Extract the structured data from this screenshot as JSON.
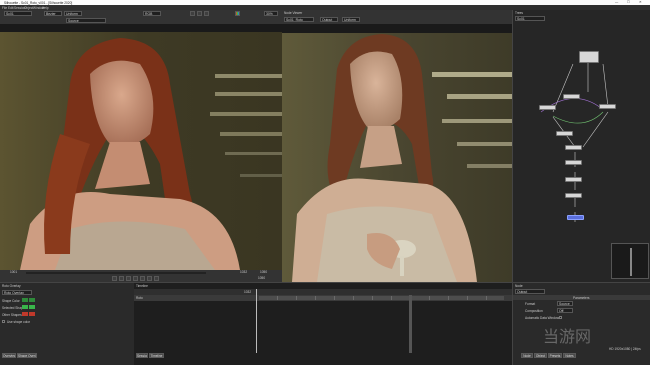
{
  "window": {
    "title": "Silhouette - Sc01_Roto_v001 - [Silhouette 2020]"
  },
  "menubar": {
    "items": [
      "File",
      "Edit",
      "Session",
      "Object",
      "Window",
      "Help"
    ]
  },
  "toolbar": {
    "session_select": "Sc01",
    "view_select": "Bezier",
    "mode_select": "Uniform",
    "color_select": "RGB",
    "zoom_value": "30%"
  },
  "left_viewer": {
    "tab_label": "Source",
    "frame_start": "1001",
    "frame_end": "1050",
    "frame_current": "1032",
    "frame_total": "1050"
  },
  "right_viewer": {
    "header": "Node Viewer",
    "tab_label": "Sc01_Roto",
    "out_select": "Output",
    "view_select": "Uniform"
  },
  "trees": {
    "header": "Trees",
    "select": "Sc01",
    "nodes": [
      "Source",
      "Roto",
      "Grade",
      "Blur",
      "Merge",
      "Paint",
      "Output"
    ]
  },
  "roto_overlay": {
    "header": "Roto Overlay",
    "select": "Roto Overlay",
    "rows": [
      {
        "label": "Shape Color",
        "swatch": "#2e8b3a"
      },
      {
        "label": "Selected Shape",
        "swatch": "#39b54a"
      },
      {
        "label": "Other Shapes",
        "swatch": "#c0392b"
      }
    ],
    "checkbox_label": "Use shape color",
    "tabs": [
      "Overview",
      "Shape Overlay"
    ]
  },
  "timeline": {
    "header": "Timeline",
    "track_label": "Roto",
    "tabs": [
      "Session",
      "Timeline"
    ],
    "frame_marker": "1032"
  },
  "node_panel": {
    "header": "Node",
    "select": "Output",
    "section": "Parameters",
    "rows": [
      {
        "label": "Format",
        "value": "Source"
      },
      {
        "label": "Composition",
        "value": "Off"
      },
      {
        "label": "Automatic Data Window",
        "value": ""
      }
    ],
    "tabs": [
      "Node",
      "Object",
      "Presets",
      "Notes"
    ],
    "status": "HD 1920x1080 | 24fps"
  },
  "watermark": {
    "text": "当游网"
  },
  "colors": {
    "accent": "#5a6edc",
    "panel_bg": "#2b2b2b",
    "viewer_bg": "#1c1c1c"
  }
}
